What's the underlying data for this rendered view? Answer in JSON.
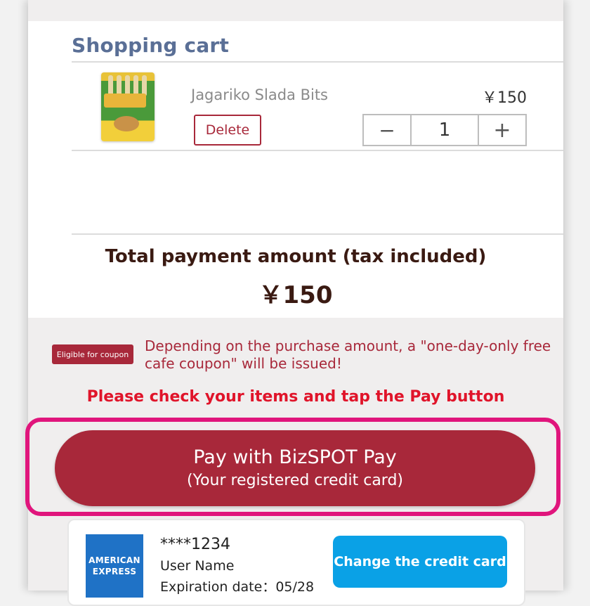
{
  "cart": {
    "title": "Shopping cart",
    "item": {
      "name": "Jagariko Slada Bits",
      "price": "￥150",
      "delete_label": "Delete",
      "qty": "1",
      "minus_symbol": "−",
      "plus_symbol": "+",
      "image_icon": "product-snack-package"
    }
  },
  "total": {
    "label": "Total payment amount (tax included)",
    "value": "￥150"
  },
  "coupon": {
    "badge": "Eligible for coupon",
    "text": "Depending on the purchase amount, a \"one-day-only free cafe coupon\" will be issued!"
  },
  "notice": "Please check your items and tap the Pay button",
  "pay_button": {
    "line1": "Pay with BizSPOT Pay",
    "line2": "(Your registered credit card)"
  },
  "credit_card": {
    "brand_line1": "AMERICAN",
    "brand_line2": "EXPRESS",
    "number": "****1234",
    "user": "User Name",
    "expiration": "Expiration date：05/28",
    "change_label": "Change the credit card"
  },
  "colors": {
    "accent": "#a8283a",
    "highlight": "#e0157c",
    "notice": "#e0142a",
    "blue_button": "#0aa1e6"
  }
}
